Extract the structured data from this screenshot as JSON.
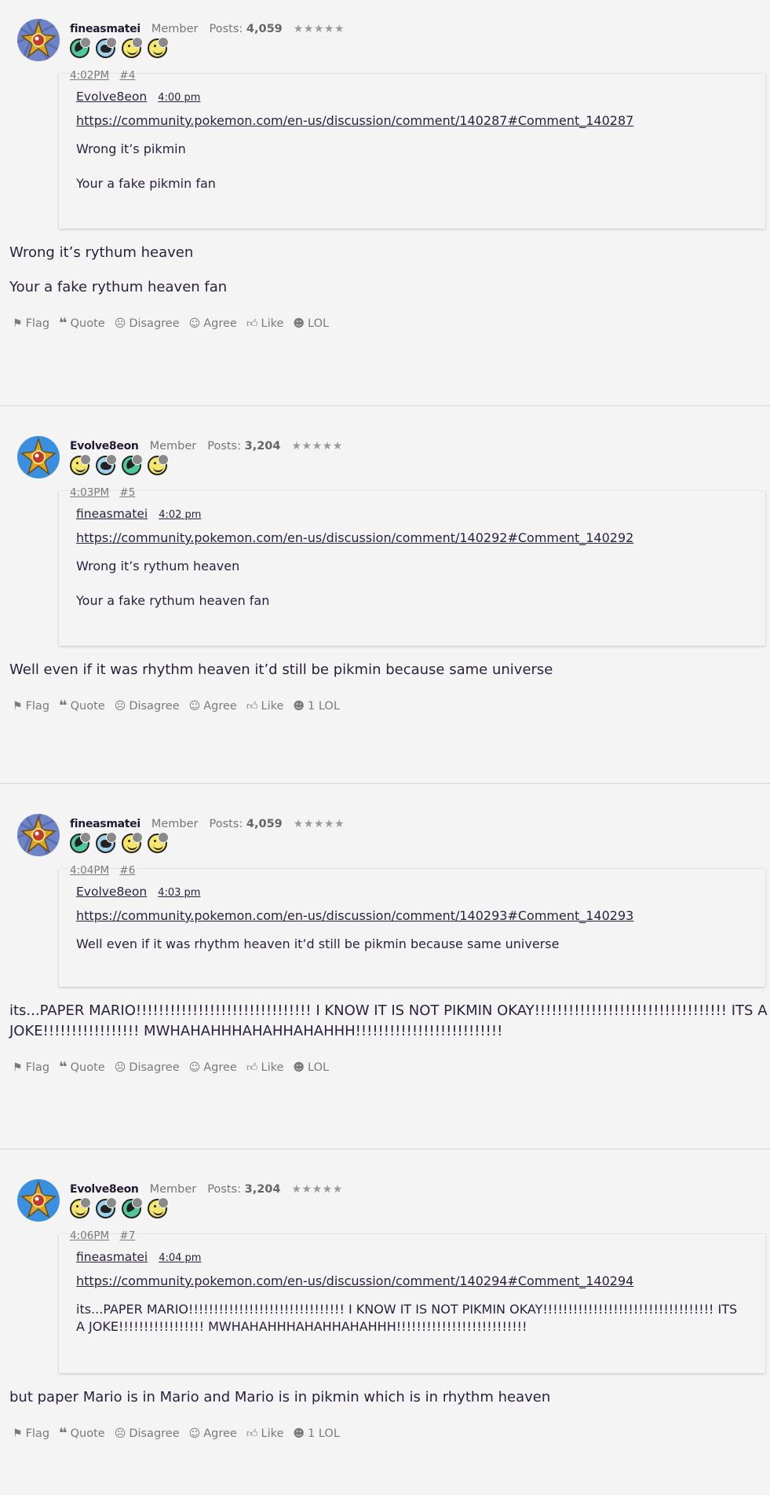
{
  "colors": {
    "background": "#f4f4f4",
    "text": "#2a1f3d",
    "muted": "#7a7a7a"
  },
  "reaction_labels": {
    "flag": "Flag",
    "quote": "Quote",
    "disagree": "Disagree",
    "agree": "Agree",
    "like": "Like"
  },
  "posts": [
    {
      "username": "fineasmatei",
      "role": "Member",
      "posts_label": "Posts:",
      "post_count": "4,059",
      "stars": "★★★★★",
      "badges": [
        "green",
        "blue",
        "yellow",
        "yellow"
      ],
      "time": "4:02PM",
      "number": "#4",
      "quote": {
        "author": "Evolve8eon",
        "time": "4:00 pm",
        "link": "https://community.pokemon.com/en-us/discussion/comment/140287#Comment_140287",
        "paragraphs": [
          "Wrong it’s pikmin",
          "Your a fake pikmin fan"
        ]
      },
      "paragraphs": [
        "Wrong it’s rythum heaven",
        "Your a fake rythum heaven fan"
      ],
      "lol": "LOL"
    },
    {
      "username": "Evolve8eon",
      "role": "Member",
      "posts_label": "Posts:",
      "post_count": "3,204",
      "stars": "★★★★★",
      "badges": [
        "yellow",
        "blue",
        "green",
        "yellow"
      ],
      "time": "4:03PM",
      "number": "#5",
      "quote": {
        "author": "fineasmatei",
        "time": "4:02 pm",
        "link": "https://community.pokemon.com/en-us/discussion/comment/140292#Comment_140292",
        "paragraphs": [
          "Wrong it’s rythum heaven",
          "Your a fake rythum heaven fan"
        ]
      },
      "paragraphs": [
        "Well even if it was rhythm heaven it’d still be pikmin because same universe"
      ],
      "lol": "1 LOL"
    },
    {
      "username": "fineasmatei",
      "role": "Member",
      "posts_label": "Posts:",
      "post_count": "4,059",
      "stars": "★★★★★",
      "badges": [
        "green",
        "blue",
        "yellow",
        "yellow"
      ],
      "time": "4:04PM",
      "number": "#6",
      "quote": {
        "author": "Evolve8eon",
        "time": "4:03 pm",
        "link": "https://community.pokemon.com/en-us/discussion/comment/140293#Comment_140293",
        "paragraphs": [
          "Well even if it was rhythm heaven it’d still be pikmin because same universe"
        ]
      },
      "paragraphs": [
        "its...PAPER MARIO!!!!!!!!!!!!!!!!!!!!!!!!!!!!!!! I KNOW IT IS NOT PIKMIN OKAY!!!!!!!!!!!!!!!!!!!!!!!!!!!!!!!!!! ITS A JOKE!!!!!!!!!!!!!!!!! MWHAHAHHHAHAHHAHAHHH!!!!!!!!!!!!!!!!!!!!!!!!!!"
      ],
      "lol": "LOL"
    },
    {
      "username": "Evolve8eon",
      "role": "Member",
      "posts_label": "Posts:",
      "post_count": "3,204",
      "stars": "★★★★★",
      "badges": [
        "yellow",
        "blue",
        "green",
        "yellow"
      ],
      "time": "4:06PM",
      "number": "#7",
      "quote": {
        "author": "fineasmatei",
        "time": "4:04 pm",
        "link": "https://community.pokemon.com/en-us/discussion/comment/140294#Comment_140294",
        "paragraphs": [
          "its...PAPER MARIO!!!!!!!!!!!!!!!!!!!!!!!!!!!!!!! I KNOW IT IS NOT PIKMIN OKAY!!!!!!!!!!!!!!!!!!!!!!!!!!!!!!!!!! ITS A JOKE!!!!!!!!!!!!!!!!! MWHAHAHHHAHAHHAHAHHH!!!!!!!!!!!!!!!!!!!!!!!!!!"
        ]
      },
      "paragraphs": [
        "but paper Mario is in Mario and Mario is in pikmin which is in rhythm heaven"
      ],
      "lol": "1 LOL"
    }
  ]
}
